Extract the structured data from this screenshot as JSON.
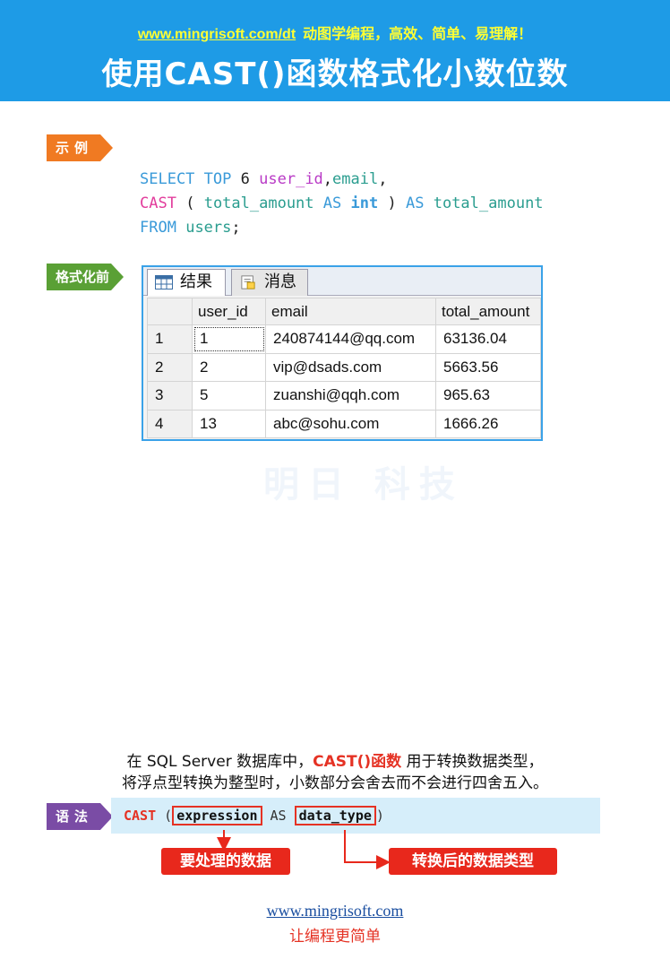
{
  "header": {
    "url": "www.mingrisoft.com/dt",
    "tagline": "动图学编程，高效、简单、易理解！",
    "title": "使用CAST()函数格式化小数位数"
  },
  "tags": {
    "example": "示例",
    "before": "格式化前",
    "syntax": "语法"
  },
  "code": {
    "line1": [
      "SELECT",
      "TOP",
      "6",
      "user_id",
      ",",
      "email",
      ","
    ],
    "line2": [
      "CAST",
      "(",
      "total_amount",
      "AS",
      "int",
      ")",
      "AS",
      "total_amount"
    ],
    "line3": [
      "FROM",
      "users",
      ";"
    ]
  },
  "grid": {
    "tab_result": "结果",
    "tab_messages": "消息",
    "columns": [
      "",
      "user_id",
      "email",
      "total_amount"
    ],
    "rows": [
      [
        "1",
        "1",
        "240874144@qq.com",
        "63136.04"
      ],
      [
        "2",
        "2",
        "vip@dsads.com",
        "5663.56"
      ],
      [
        "3",
        "5",
        "zuanshi@qqh.com",
        "965.63"
      ],
      [
        "4",
        "13",
        "abc@sohu.com",
        "1666.26"
      ]
    ]
  },
  "watermark": "明日 科技",
  "description": {
    "line1_pre": "在 SQL Server 数据库中，",
    "line1_highlight": "CAST()函数",
    "line1_post": " 用于转换数据类型，",
    "line2": "将浮点型转换为整型时，小数部分会舍去而不会进行四舍五入。"
  },
  "syntax": {
    "cast": "CAST",
    "open": "(",
    "expression": "expression",
    "as": "AS",
    "data_type": "data_type",
    "close": ")"
  },
  "annotations": {
    "expression": "要处理的数据",
    "data_type": "转换后的数据类型"
  },
  "footer": {
    "url": "www.mingrisoft.com",
    "slogan": "让编程更简单"
  },
  "colors": {
    "header_bg": "#1e9be6",
    "accent_red": "#e53224",
    "example_tag": "#f07a22",
    "before_tag": "#5aa035",
    "syntax_tag": "#7a4ca5"
  }
}
